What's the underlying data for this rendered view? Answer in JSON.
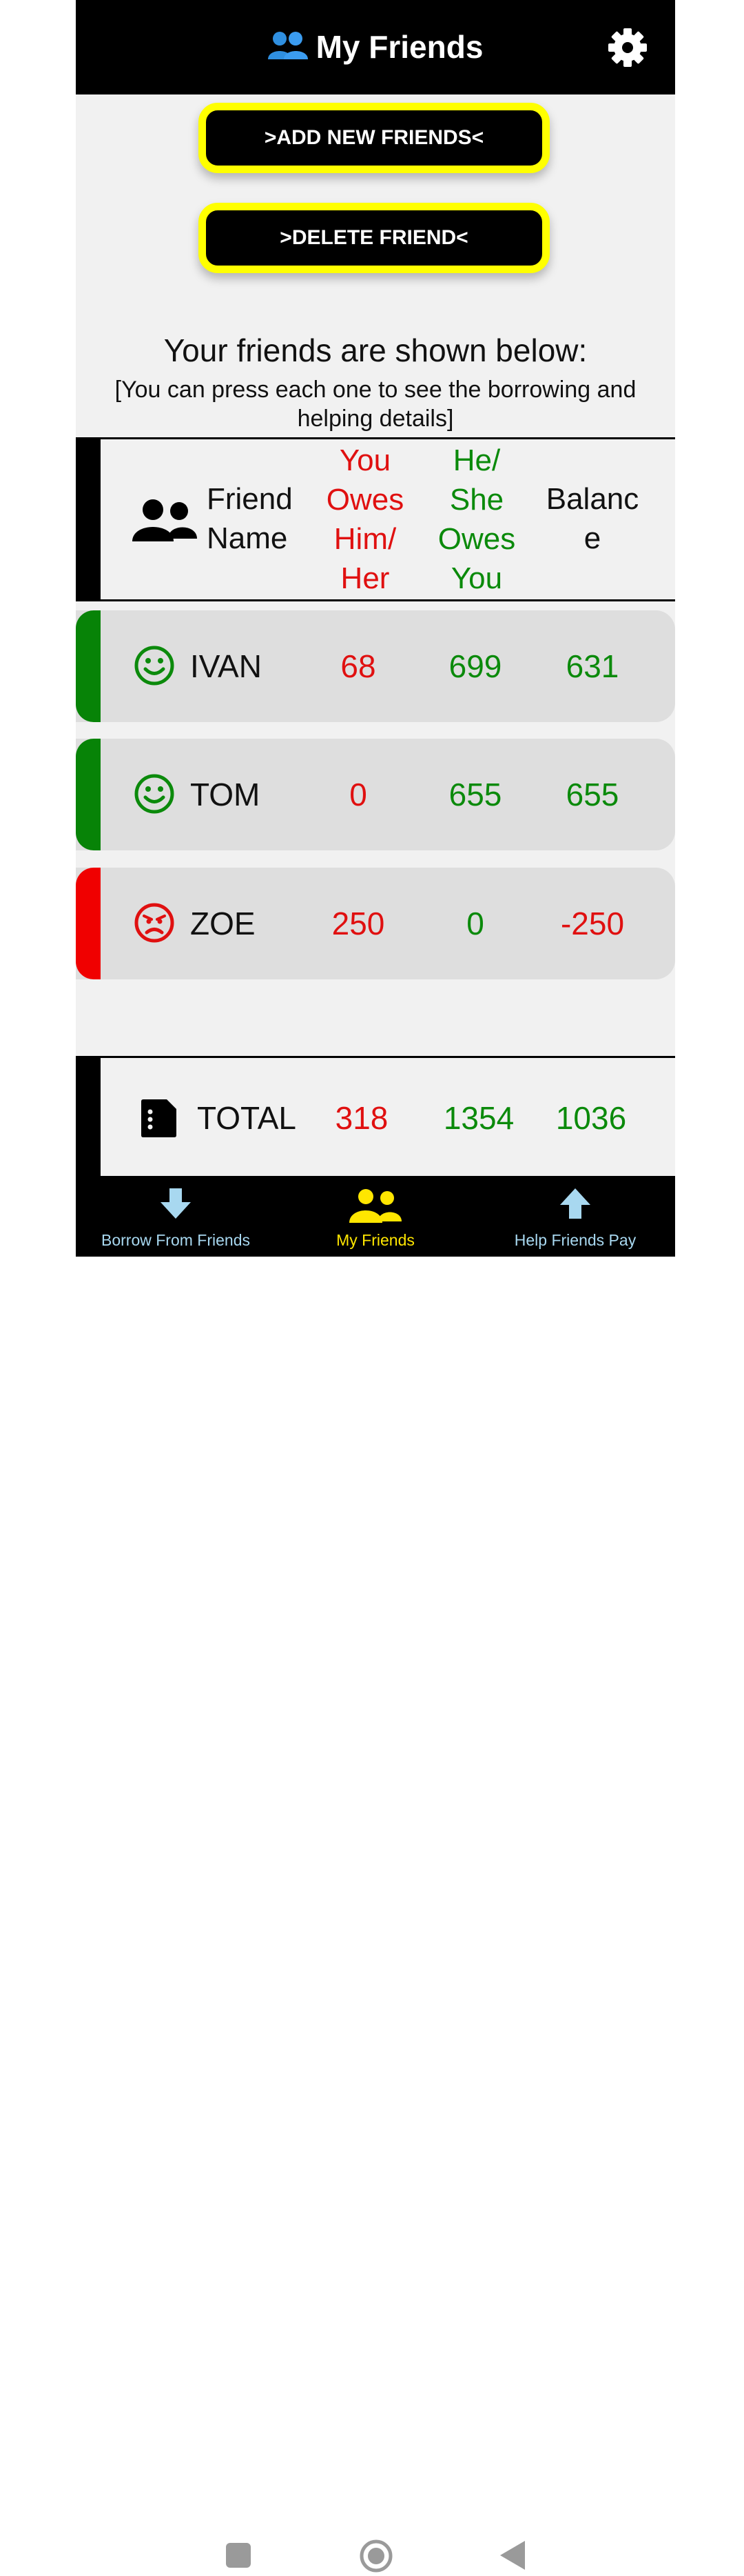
{
  "header": {
    "title": "My Friends"
  },
  "buttons": {
    "add": ">ADD NEW FRIENDS<",
    "delete": ">DELETE FRIEND<"
  },
  "info": {
    "title": "Your friends are shown below:",
    "subtitle": "[You can press each one to see the borrowing and helping details]"
  },
  "table_header": {
    "name_line1": "Friend",
    "name_line2": "Name",
    "owe_l1": "You",
    "owe_l2": "Owes",
    "owe_l3": "Him/",
    "owe_l4": "Her",
    "owed_l1": "He/",
    "owed_l2": "She",
    "owed_l3": "Owes",
    "owed_l4": "You",
    "bal_l1": "Balanc",
    "bal_l2": "e"
  },
  "friends": [
    {
      "name": "IVAN",
      "you_owe": "68",
      "owes_you": "699",
      "balance": "631",
      "status": "positive"
    },
    {
      "name": "TOM",
      "you_owe": "0",
      "owes_you": "655",
      "balance": "655",
      "status": "positive"
    },
    {
      "name": "ZOE",
      "you_owe": "250",
      "owes_you": "0",
      "balance": "-250",
      "status": "negative"
    }
  ],
  "total": {
    "label": "TOTAL",
    "you_owe": "318",
    "owes_you": "1354",
    "balance": "1036"
  },
  "nav": {
    "borrow": "Borrow From Friends",
    "friends": "My Friends",
    "help": "Help Friends Pay"
  },
  "colors": {
    "positive": "#0b8a0b",
    "negative": "#e01010",
    "active_nav": "#ffe600",
    "inactive_nav": "#a8d8f0",
    "button_border": "#ffff00"
  }
}
